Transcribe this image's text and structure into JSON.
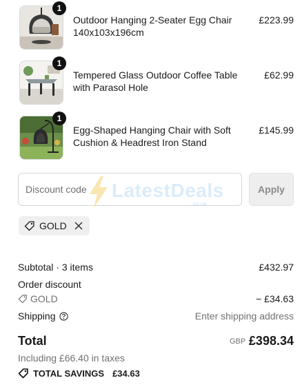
{
  "items": [
    {
      "qty": "1",
      "name": "Outdoor Hanging 2-Seater Egg Chair 140x103x196cm",
      "price": "£223.99",
      "thumb_icon": "egg-chair-photo"
    },
    {
      "qty": "1",
      "name": "Tempered Glass Outdoor Coffee Table with Parasol Hole",
      "price": "£62.99",
      "thumb_icon": "coffee-table-photo"
    },
    {
      "qty": "1",
      "name": "Egg-Shaped Hanging Chair with Soft Cushion & Headrest Iron Stand",
      "price": "£145.99",
      "thumb_icon": "hanging-chair-garden-photo"
    }
  ],
  "discount": {
    "placeholder": "Discount code",
    "apply_label": "Apply"
  },
  "watermark": {
    "text": "LatestDeals",
    "sub": ".co.uk"
  },
  "applied_code": {
    "code": "GOLD",
    "tag_icon": "tag-icon",
    "remove_icon": "close-icon"
  },
  "summary": {
    "subtotal_label": "Subtotal · 3 items",
    "subtotal_value": "£432.97",
    "order_discount_label": "Order discount",
    "discount_code": "GOLD",
    "discount_value": "− £34.63",
    "shipping_label": "Shipping",
    "shipping_value": "Enter shipping address",
    "total_label": "Total",
    "currency": "GBP",
    "total_value": "£398.34",
    "taxes_text": "Including £66.40 in taxes",
    "savings_label": "TOTAL SAVINGS",
    "savings_value": "£34.63"
  },
  "colors": {
    "accent": "#111111",
    "muted": "#707070",
    "disabled_button": "#eeeeee"
  }
}
